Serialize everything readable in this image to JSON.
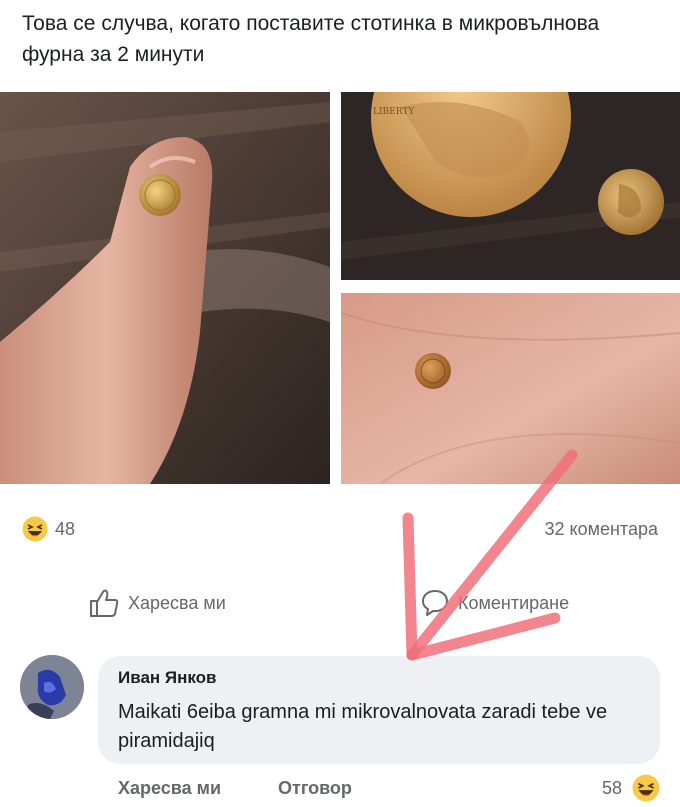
{
  "post": {
    "text": "Това се случва, когато поставите стотинка в микровълнова фурна за 2 минути"
  },
  "photos": [
    {
      "name": "finger-with-tiny-coin"
    },
    {
      "name": "penny-and-tiny-coin-on-table"
    },
    {
      "name": "tiny-coin-on-palm"
    }
  ],
  "reactions": {
    "emoji_icon": "haha-emoji-icon",
    "count": "48",
    "comments_count": "32 коментара"
  },
  "actions": {
    "like_label": "Харесва ми",
    "comment_label": "Коментиране"
  },
  "comment": {
    "author": "Иван Янков",
    "text": "Maikati 6eiba gramna mi mikrovalnovata zaradi tebe ve piramidajiq",
    "like_label": "Харесва ми",
    "reply_label": "Отговор",
    "reaction_count": "58",
    "reaction_icon": "haha-emoji-icon"
  },
  "colors": {
    "arrow": "#f0707a",
    "secondary_text": "#65676b",
    "bubble": "#eef0f3"
  }
}
